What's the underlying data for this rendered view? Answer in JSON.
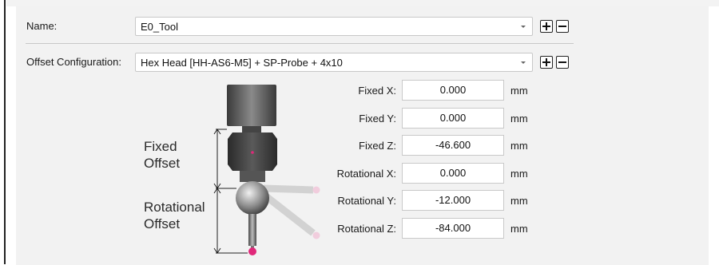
{
  "name_row": {
    "label": "Name:",
    "value": "E0_Tool"
  },
  "offset_row": {
    "label": "Offset Configuration:",
    "value": "Hex Head [HH-AS6-M5] + SP-Probe + 4x10"
  },
  "diagram": {
    "fixed_label_line1": "Fixed",
    "fixed_label_line2": "Offset",
    "rotational_label_line1": "Rotational",
    "rotational_label_line2": "Offset"
  },
  "fields": [
    {
      "label": "Fixed X:",
      "value": "0.000",
      "unit": "mm"
    },
    {
      "label": "Fixed Y:",
      "value": "0.000",
      "unit": "mm"
    },
    {
      "label": "Fixed Z:",
      "value": "-46.600",
      "unit": "mm"
    },
    {
      "label": "Rotational X:",
      "value": "0.000",
      "unit": "mm"
    },
    {
      "label": "Rotational Y:",
      "value": "-12.000",
      "unit": "mm"
    },
    {
      "label": "Rotational Z:",
      "value": "-84.000",
      "unit": "mm"
    }
  ],
  "colors": {
    "panel_bg": "#f2f2f2",
    "probe_tip": "#e0287a",
    "probe_body": "#555555"
  }
}
